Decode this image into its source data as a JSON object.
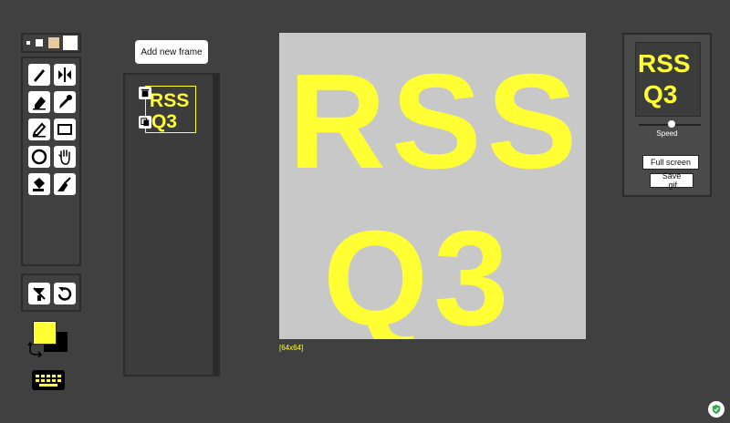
{
  "header": {
    "add_frame_label": "Add new frame"
  },
  "tools": [
    "pen-icon",
    "mirror-pen-icon",
    "eraser-icon",
    "color-picker-icon",
    "stroke-icon",
    "rectangle-icon",
    "circle-icon",
    "move-hand-icon",
    "paint-bucket-icon",
    "lighten-icon"
  ],
  "actions": [
    "clear-icon",
    "undo-icon"
  ],
  "colors": {
    "primary": "#ffff33",
    "secondary": "#000000",
    "canvas_bg": "#c8c8c8"
  },
  "canvas": {
    "size_label": "[64x64]"
  },
  "preview": {
    "speed_label": "Speed",
    "speed_value": 0.5,
    "fullscreen_label": "Full screen",
    "save_gif_label": "Save .gif"
  },
  "art": {
    "line1": "RSS",
    "line2": "Q3"
  }
}
